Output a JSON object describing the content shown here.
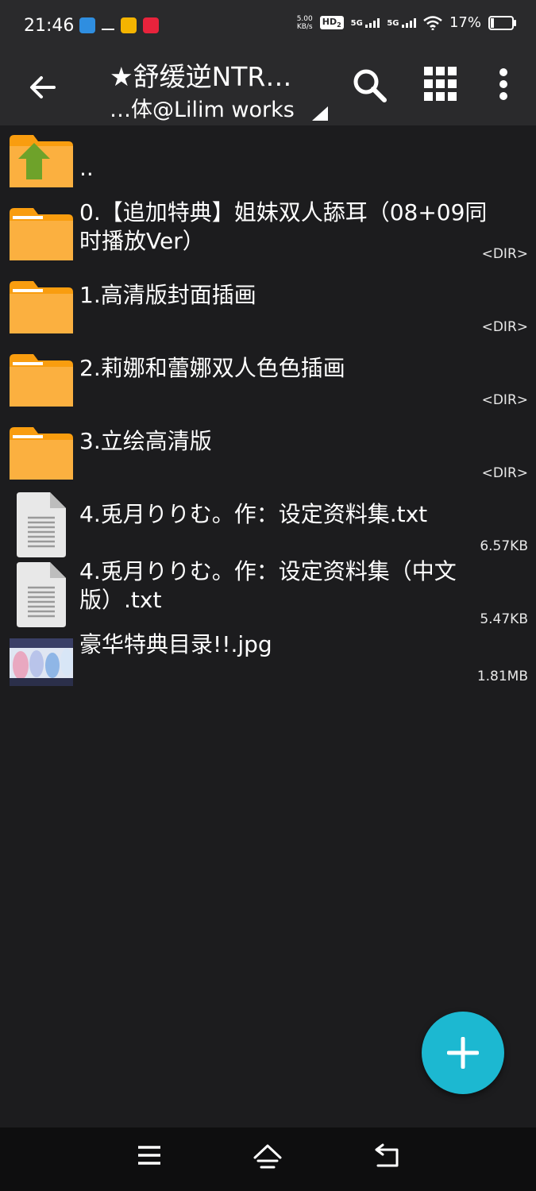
{
  "status_bar": {
    "time": "21:46",
    "net_speed_value": "5.00",
    "net_speed_unit": "KB/s",
    "hd_label": "HD",
    "hd_sub": "2",
    "signal1_label": "5G",
    "signal2_label": "5G",
    "battery_percent": "17%",
    "battery_level": 0.17,
    "icons": [
      "app-icon",
      "checklist-icon",
      "app-icon",
      "app-icon",
      "wifi-icon",
      "battery-icon"
    ]
  },
  "app_bar": {
    "title": "★舒缓逆NTR…",
    "subtitle": "…体@Lilim works"
  },
  "files": [
    {
      "name": "..",
      "meta": "",
      "type": "parent"
    },
    {
      "name": "0.【追加特典】姐妹双人舔耳（08+09同时播放Ver）",
      "meta": "<DIR>",
      "type": "folder"
    },
    {
      "name": "1.高清版封面插画",
      "meta": "<DIR>",
      "type": "folder"
    },
    {
      "name": "2.莉娜和蕾娜双人色色插画",
      "meta": "<DIR>",
      "type": "folder"
    },
    {
      "name": "3.立绘高清版",
      "meta": "<DIR>",
      "type": "folder"
    },
    {
      "name": "4.兎月りりむ。作：设定资料集.txt",
      "meta": "6.57KB",
      "type": "text"
    },
    {
      "name": "4.兎月りりむ。作：设定资料集（中文版）.txt",
      "meta": "5.47KB",
      "type": "text"
    },
    {
      "name": "豪华特典目录!!.jpg",
      "meta": "1.81MB",
      "type": "image"
    }
  ],
  "colors": {
    "background": "#1c1c1e",
    "bar": "#2a2a2c",
    "folder": "#f99d0f",
    "fab": "#1cb8d1",
    "arrow": "#6ea22a"
  }
}
